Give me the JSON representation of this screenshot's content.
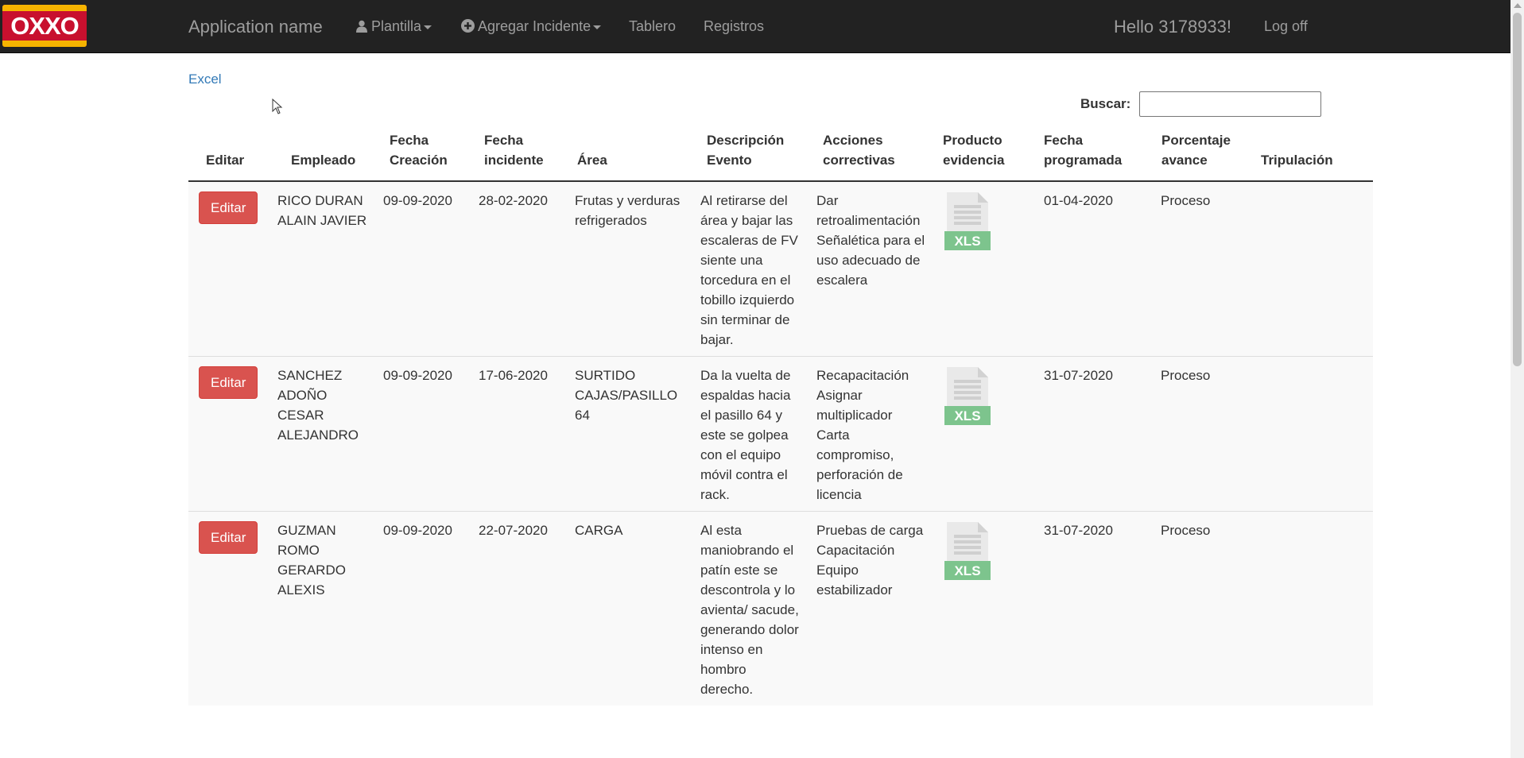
{
  "navbar": {
    "brand": "Application name",
    "menu": [
      {
        "label": "Plantilla",
        "icon": "user-icon",
        "dropdown": true
      },
      {
        "label": "Agregar Incidente",
        "icon": "plus-circle-icon",
        "dropdown": true
      },
      {
        "label": "Tablero",
        "dropdown": false
      },
      {
        "label": "Registros",
        "dropdown": false
      }
    ],
    "hello": "Hello 3178933!",
    "logoff": "Log off"
  },
  "logo": {
    "text": "OXXO",
    "colors": {
      "red": "#c8102e",
      "yellow": "#f6b400"
    }
  },
  "excel_link": "Excel",
  "search": {
    "label": "Buscar:",
    "value": "",
    "placeholder": ""
  },
  "table": {
    "headers": [
      "Editar",
      "Empleado",
      "Fecha Creación",
      "Fecha incidente",
      "Área",
      "Descripción Evento",
      "Acciones correctivas",
      "Producto evidencia",
      "Fecha programada",
      "Porcentaje avance",
      "Tripulación"
    ],
    "edit_label": "Editar",
    "xls_label": "XLS",
    "rows": [
      {
        "empleado": "RICO DURAN ALAIN JAVIER",
        "fecha_creacion": "09-09-2020",
        "fecha_incidente": "28-02-2020",
        "area": "Frutas y verduras refrigerados",
        "descripcion": "Al retirarse del área y bajar las escaleras de FV siente una torcedura en el tobillo izquierdo sin terminar de bajar.",
        "acciones": "Dar retroalimentación Señalética para el uso adecuado de escalera",
        "fecha_programada": "01-04-2020",
        "avance": "Proceso",
        "tripulacion": ""
      },
      {
        "empleado": "SANCHEZ ADOÑO CESAR ALEJANDRO",
        "fecha_creacion": "09-09-2020",
        "fecha_incidente": "17-06-2020",
        "area": "SURTIDO CAJAS/PASILLO 64",
        "descripcion": "Da la vuelta de espaldas hacia el pasillo 64 y este se golpea con el equipo móvil contra el rack.",
        "acciones": "Recapacitación Asignar multiplicador Carta compromiso, perforación de licencia",
        "fecha_programada": "31-07-2020",
        "avance": "Proceso",
        "tripulacion": ""
      },
      {
        "empleado": "GUZMAN ROMO GERARDO ALEXIS",
        "fecha_creacion": "09-09-2020",
        "fecha_incidente": "22-07-2020",
        "area": "CARGA",
        "descripcion": "Al esta maniobrando el patín este se descontrola y lo avienta/ sacude, generando dolor intenso en hombro derecho.",
        "acciones": "Pruebas de carga Capacitación Equipo estabilizador",
        "fecha_programada": "31-07-2020",
        "avance": "Proceso",
        "tripulacion": ""
      }
    ]
  },
  "colors": {
    "navbar_bg": "#222222",
    "link": "#337ab7",
    "danger": "#d9534f",
    "xls_green": "#7dc48d"
  }
}
